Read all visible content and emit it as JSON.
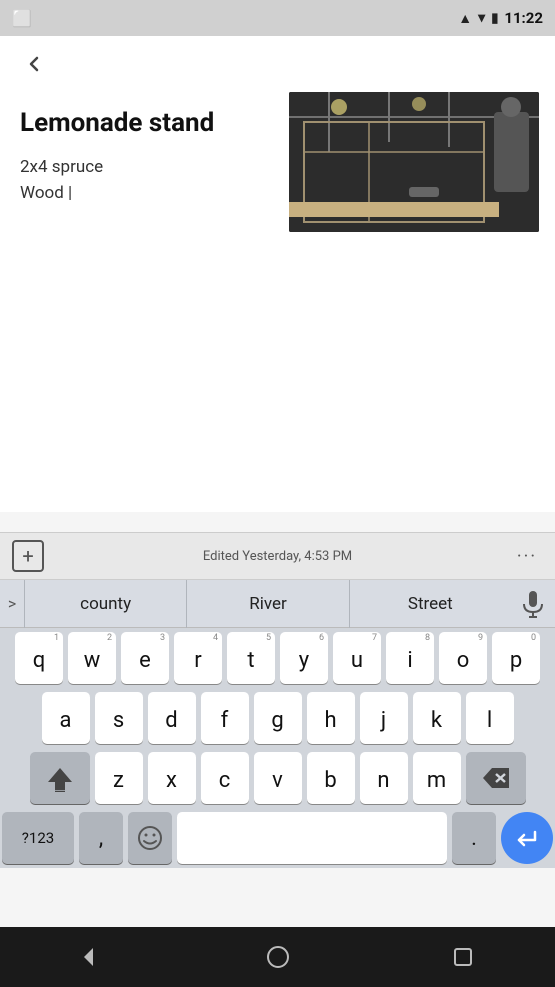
{
  "status": {
    "time": "11:22",
    "signal": "▲",
    "wifi": "▾",
    "battery": "🔋"
  },
  "toolbar": {
    "back_label": "←"
  },
  "note": {
    "title": "Lemonade stand",
    "body_line1": "2x4 spruce",
    "body_line2": "Wood |"
  },
  "bottom_bar": {
    "plus_label": "+",
    "edit_status": "Edited Yesterday, 4:53 PM",
    "more_label": "···"
  },
  "suggestions": {
    "arrow": ">",
    "items": [
      "county",
      "River",
      "Street"
    ],
    "mic": "🎤"
  },
  "keyboard": {
    "row1": [
      {
        "letter": "q",
        "number": "1"
      },
      {
        "letter": "w",
        "number": "2"
      },
      {
        "letter": "e",
        "number": "3"
      },
      {
        "letter": "r",
        "number": "4"
      },
      {
        "letter": "t",
        "number": "5"
      },
      {
        "letter": "y",
        "number": "6"
      },
      {
        "letter": "u",
        "number": "7"
      },
      {
        "letter": "i",
        "number": "8"
      },
      {
        "letter": "o",
        "number": "9"
      },
      {
        "letter": "p",
        "number": "0"
      }
    ],
    "row2": [
      {
        "letter": "a"
      },
      {
        "letter": "s"
      },
      {
        "letter": "d"
      },
      {
        "letter": "f"
      },
      {
        "letter": "g"
      },
      {
        "letter": "h"
      },
      {
        "letter": "j"
      },
      {
        "letter": "k"
      },
      {
        "letter": "l"
      }
    ],
    "row3": [
      {
        "letter": "z"
      },
      {
        "letter": "x"
      },
      {
        "letter": "c"
      },
      {
        "letter": "v"
      },
      {
        "letter": "b"
      },
      {
        "letter": "n"
      },
      {
        "letter": "m"
      }
    ],
    "num_label": "?123",
    "comma_label": ",",
    "period_label": ".",
    "space_label": ""
  },
  "nav": {
    "back_triangle": "▼",
    "home_circle": "○",
    "recent_square": "□"
  }
}
